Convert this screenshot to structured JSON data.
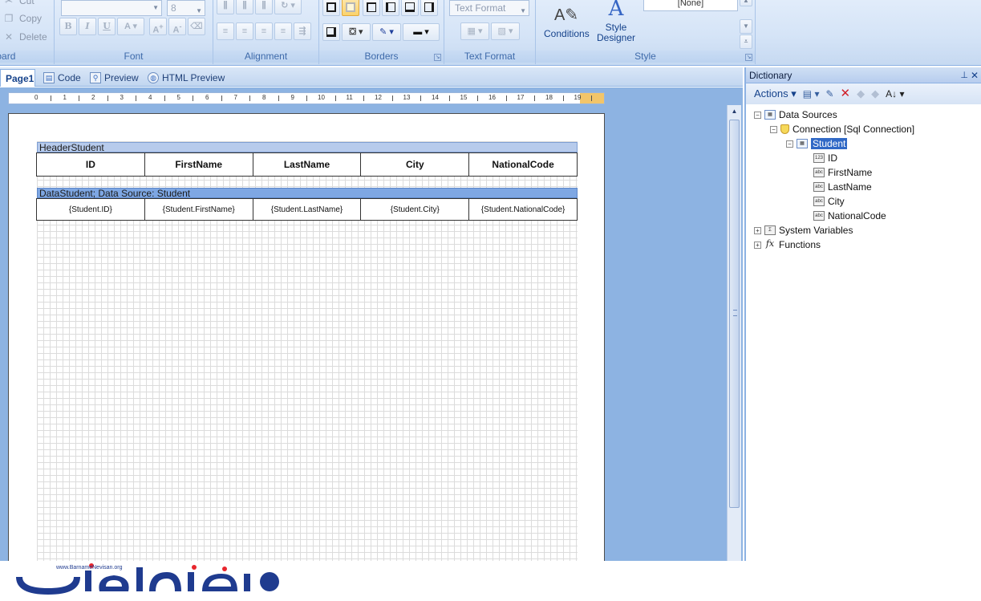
{
  "ribbon": {
    "clipboard": {
      "cut": "Cut",
      "copy": "Copy",
      "delete": "Delete",
      "label": "Clipboard"
    },
    "font": {
      "label": "Font",
      "font_name": "",
      "font_size": "8"
    },
    "alignment": {
      "label": "Alignment"
    },
    "borders": {
      "label": "Borders"
    },
    "text_format": {
      "label": "Text Format",
      "combo": "Text Format"
    },
    "style": {
      "label": "Style",
      "conditions": "Conditions",
      "style_designer": "Style Designer",
      "style_combo": "[None]"
    }
  },
  "tabs": [
    {
      "label": "Page1"
    },
    {
      "label": "Code"
    },
    {
      "label": "Preview"
    },
    {
      "label": "HTML Preview"
    }
  ],
  "ruler": [
    "0",
    "1",
    "2",
    "3",
    "4",
    "5",
    "6",
    "7",
    "8",
    "9",
    "10",
    "11",
    "12",
    "13",
    "14",
    "15",
    "16",
    "17",
    "18",
    "19"
  ],
  "report": {
    "header_band": "HeaderStudent",
    "header_cells": [
      "ID",
      "FirstName",
      "LastName",
      "City",
      "NationalCode"
    ],
    "data_band": "DataStudent; Data Source: Student",
    "data_cells": [
      "{Student.ID}",
      "{Student.FirstName}",
      "{Student.LastName}",
      "{Student.City}",
      "{Student.NationalCode}"
    ]
  },
  "dictionary": {
    "title": "Dictionary",
    "actions": "Actions",
    "tree": {
      "data_sources": "Data Sources",
      "connection": "Connection [Sql Connection]",
      "table": "Student",
      "fields": [
        {
          "name": "ID",
          "type_icon": "123"
        },
        {
          "name": "FirstName",
          "type_icon": "abc"
        },
        {
          "name": "LastName",
          "type_icon": "abc"
        },
        {
          "name": "City",
          "type_icon": "abc"
        },
        {
          "name": "NationalCode",
          "type_icon": "abc"
        }
      ],
      "system_variables": "System Variables",
      "functions": "Functions"
    }
  },
  "watermark": {
    "url": "www.BarnameNevisan.org"
  },
  "colors": {
    "ribbon_bg": "#d5e4f7",
    "designer_bg": "#8db3e2",
    "selection": "#3169c6",
    "data_band": "#7ea7e3"
  }
}
